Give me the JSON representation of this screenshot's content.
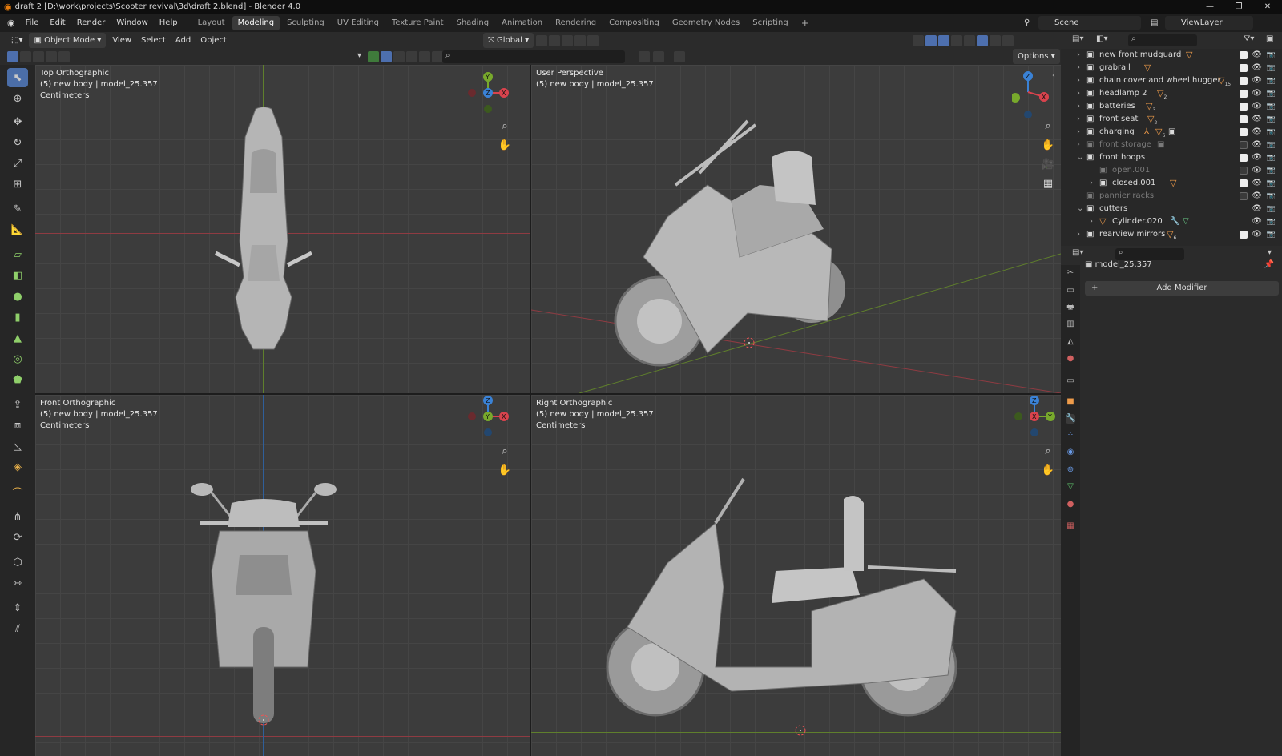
{
  "window": {
    "title": "draft 2 [D:\\work\\projects\\Scooter revival\\3d\\draft 2.blend] - Blender 4.0"
  },
  "menus": [
    "File",
    "Edit",
    "Render",
    "Window",
    "Help"
  ],
  "workspaces": [
    "Layout",
    "Modeling",
    "Sculpting",
    "UV Editing",
    "Texture Paint",
    "Shading",
    "Animation",
    "Rendering",
    "Compositing",
    "Geometry Nodes",
    "Scripting"
  ],
  "active_workspace": "Modeling",
  "scene": {
    "name": "Scene"
  },
  "view_layer": {
    "name": "ViewLayer"
  },
  "header": {
    "mode": "Object Mode",
    "view": "View",
    "select": "Select",
    "add": "Add",
    "object": "Object",
    "transform_orientation": "Global",
    "options": "Options"
  },
  "viewports": {
    "top": {
      "title": "Top Orthographic",
      "object": "(5) new body | model_25.357",
      "units": "Centimeters"
    },
    "persp": {
      "title": "User Perspective",
      "object": "(5) new body | model_25.357",
      "units": "Centimeters"
    },
    "front": {
      "title": "Front Orthographic",
      "object": "(5) new body | model_25.357",
      "units": "Centimeters"
    },
    "right": {
      "title": "Right Orthographic",
      "object": "(5) new body | model_25.357",
      "units": "Centimeters"
    }
  },
  "outliner": {
    "rows": [
      {
        "label": "new front mudguard",
        "subscript": ""
      },
      {
        "label": "grabrail",
        "subscript": ""
      },
      {
        "label": "chain cover and wheel hugger",
        "subscript": "15"
      },
      {
        "label": "headlamp 2",
        "subscript": "2"
      },
      {
        "label": "batteries",
        "subscript": "3"
      },
      {
        "label": "front seat",
        "subscript": "2"
      },
      {
        "label": "charging",
        "subscript": "6"
      },
      {
        "label": "front storage",
        "subscript": ""
      },
      {
        "label": "front hoops",
        "subscript": ""
      },
      {
        "label": "open.001",
        "subscript": ""
      },
      {
        "label": "closed.001",
        "subscript": ""
      },
      {
        "label": "pannier racks",
        "subscript": ""
      },
      {
        "label": "cutters",
        "subscript": ""
      },
      {
        "label": "Cylinder.020",
        "subscript": ""
      },
      {
        "label": "rearview mirrors",
        "subscript": "6"
      }
    ]
  },
  "properties": {
    "object_name": "model_25.357",
    "add_modifier": "Add Modifier"
  },
  "colors": {
    "accent": "#4b6ea8",
    "x_axis": "#d9434d",
    "y_axis": "#78a92c",
    "z_axis": "#3a82d6",
    "viewport_bg": "#3c3c3c"
  }
}
